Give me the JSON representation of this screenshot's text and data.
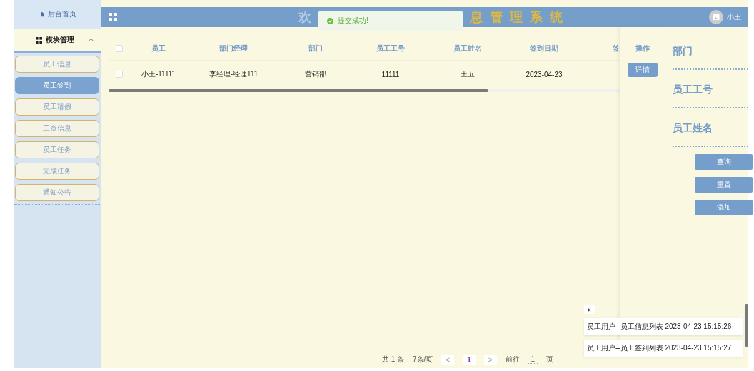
{
  "sidebar": {
    "home": "后台首页",
    "group": {
      "label": "模块管理",
      "expanded": true
    },
    "items": [
      {
        "label": "员工信息",
        "selected": false
      },
      {
        "label": "员工签到",
        "selected": true
      },
      {
        "label": "员工请假",
        "selected": false
      },
      {
        "label": "工资信息",
        "selected": false
      },
      {
        "label": "员工任务",
        "selected": false
      },
      {
        "label": "完成任务",
        "selected": false
      },
      {
        "label": "通知公告",
        "selected": false
      }
    ]
  },
  "header": {
    "title_start": "欢",
    "title_end": "息管理系统",
    "user": "小王"
  },
  "toast": {
    "message": "提交成功!"
  },
  "table": {
    "all_checked": false,
    "columns": [
      "员工",
      "部门经理",
      "部门",
      "员工工号",
      "员工姓名",
      "签到日期",
      "签"
    ],
    "action_column": "操作",
    "rows": [
      {
        "checked": false,
        "cells": [
          "小王-11111",
          "李经理-经理111",
          "营销部",
          "11111",
          "王五",
          "2023-04-23"
        ],
        "action": "详情"
      }
    ]
  },
  "search": {
    "fields": [
      "部门",
      "员工工号",
      "员工姓名"
    ],
    "buttons": [
      "查询",
      "重置",
      "添加"
    ]
  },
  "notifications": {
    "close": "x",
    "items": [
      "员工用户--员工信息列表 2023-04-23 15:15:26",
      "员工用户--员工签到列表 2023-04-23 15:15:27"
    ]
  },
  "pagination": {
    "total": "共 1 条",
    "page_size": "7条/页",
    "prev": "<",
    "current": "1",
    "next": ">",
    "goto": "前往",
    "goto_value": "1",
    "page_unit": "页"
  }
}
